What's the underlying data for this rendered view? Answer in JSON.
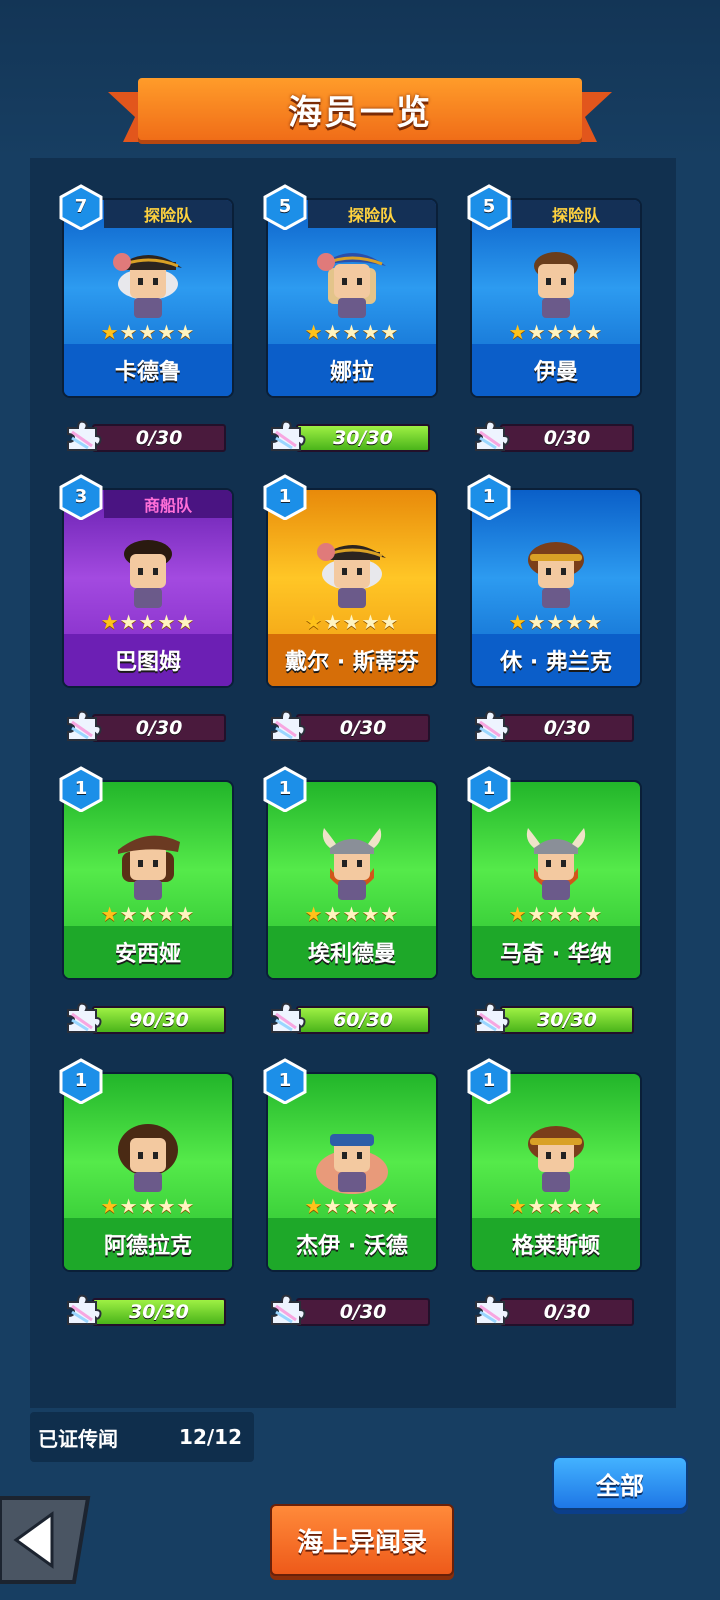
{
  "header": {
    "title": "海员一览"
  },
  "crew": [
    {
      "name": "卡德鲁",
      "level": "7",
      "team": "探险队",
      "color": "blue",
      "stars": 1,
      "progress": "0/30",
      "fill": 0,
      "portrait": "pirate-captain-portrait"
    },
    {
      "name": "娜拉",
      "level": "5",
      "team": "探险队",
      "color": "blue",
      "stars": 1,
      "progress": "30/30",
      "fill": 1,
      "portrait": "blonde-officer-portrait"
    },
    {
      "name": "伊曼",
      "level": "5",
      "team": "探险队",
      "color": "blue",
      "stars": 1,
      "progress": "0/30",
      "fill": 0,
      "portrait": "curly-hair-portrait"
    },
    {
      "name": "巴图姆",
      "level": "3",
      "team": "商船队",
      "color": "purple",
      "stars": 1,
      "progress": "0/30",
      "fill": 0,
      "portrait": "robed-merchant-portrait"
    },
    {
      "name": "戴尔 · 斯蒂芬",
      "level": "1",
      "team": "",
      "color": "orange",
      "stars": 1,
      "progress": "0/30",
      "fill": 0,
      "portrait": "pirate-captain-portrait"
    },
    {
      "name": "休 · 弗兰克",
      "level": "1",
      "team": "",
      "color": "blue",
      "stars": 1,
      "progress": "0/30",
      "fill": 0,
      "portrait": "headband-portrait"
    },
    {
      "name": "安西娅",
      "level": "1",
      "team": "",
      "color": "green",
      "stars": 1,
      "progress": "90/30",
      "fill": 1,
      "portrait": "brown-hat-portrait"
    },
    {
      "name": "埃利德曼",
      "level": "1",
      "team": "",
      "color": "green",
      "stars": 1,
      "progress": "60/30",
      "fill": 1,
      "portrait": "viking-portrait"
    },
    {
      "name": "马奇 · 华纳",
      "level": "1",
      "team": "",
      "color": "green",
      "stars": 1,
      "progress": "30/30",
      "fill": 1,
      "portrait": "viking-portrait"
    },
    {
      "name": "阿德拉克",
      "level": "1",
      "team": "",
      "color": "green",
      "stars": 1,
      "progress": "30/30",
      "fill": 1,
      "portrait": "bearded-portrait"
    },
    {
      "name": "杰伊 · 沃德",
      "level": "1",
      "team": "",
      "color": "green",
      "stars": 1,
      "progress": "0/30",
      "fill": 0,
      "portrait": "sailor-portrait"
    },
    {
      "name": "格莱斯顿",
      "level": "1",
      "team": "",
      "color": "green",
      "stars": 1,
      "progress": "0/30",
      "fill": 0,
      "portrait": "headband-portrait"
    }
  ],
  "footer": {
    "legend_label": "已证传闻",
    "legend_value": "12/12",
    "filter_button": "全部",
    "bottom_button": "海上异闻录"
  }
}
